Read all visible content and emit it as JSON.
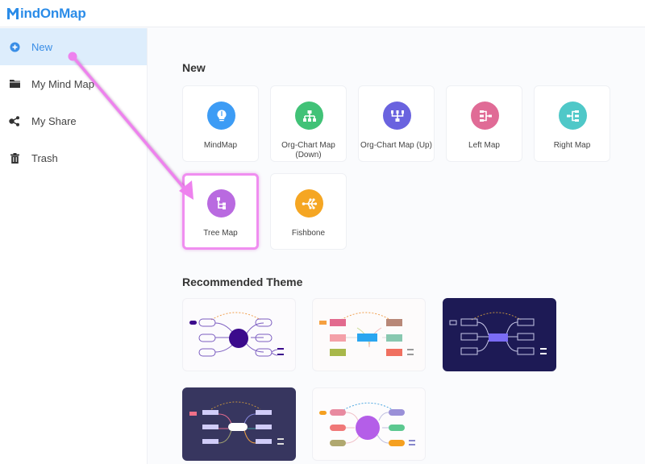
{
  "app": {
    "logo_text": "indOnMap",
    "logo_initial": "M",
    "brand_color": "#2b8ce8"
  },
  "sidebar": {
    "items": [
      {
        "label": "New",
        "icon": "plus-circle-icon",
        "active": true
      },
      {
        "label": "My Mind Map",
        "icon": "folder-icon",
        "active": false
      },
      {
        "label": "My Share",
        "icon": "share-icon",
        "active": false
      },
      {
        "label": "Trash",
        "icon": "trash-icon",
        "active": false
      }
    ]
  },
  "main": {
    "new_title": "New",
    "templates": [
      {
        "label": "MindMap",
        "icon": "lightbulb-icon",
        "color": "#3d9cf5"
      },
      {
        "label": "Org-Chart Map (Down)",
        "line1": "Org-Chart Map",
        "line2": "(Down)",
        "icon": "org-chart-down-icon",
        "color": "#41c277"
      },
      {
        "label": "Org-Chart Map (Up)",
        "icon": "org-chart-up-icon",
        "color": "#6a63df"
      },
      {
        "label": "Left Map",
        "icon": "left-map-icon",
        "color": "#e06b96"
      },
      {
        "label": "Right Map",
        "icon": "right-map-icon",
        "color": "#4fc8c8"
      },
      {
        "label": "Tree Map",
        "icon": "tree-map-icon",
        "color": "#b96ae0",
        "highlighted": true
      },
      {
        "label": "Fishbone",
        "icon": "fishbone-icon",
        "color": "#f5a623"
      }
    ],
    "theme_title": "Recommended Theme",
    "themes": [
      {
        "name": "theme-purple-classic",
        "background": "#fcfbfd"
      },
      {
        "name": "theme-colorful-rect",
        "background": "#fdfbfb"
      },
      {
        "name": "theme-dark-navy",
        "background": "#1d1a55"
      },
      {
        "name": "theme-dark-slate",
        "background": "#37365f"
      },
      {
        "name": "theme-pastel-circle",
        "background": "#fdfcfd"
      }
    ]
  },
  "annotation": {
    "color": "#ee82ee",
    "description": "arrow from New to Tree Map"
  }
}
